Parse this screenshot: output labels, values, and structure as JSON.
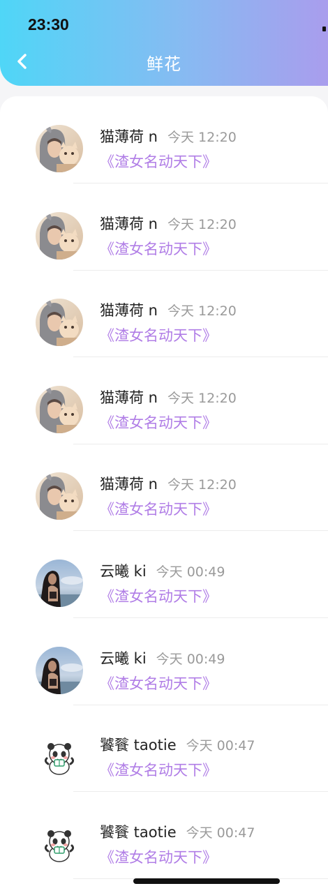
{
  "status_bar": {
    "time": "23:30"
  },
  "header": {
    "title": "鲜花",
    "back_icon": "chevron-left-icon"
  },
  "colors": {
    "header_gradient": [
      "#4fd6f7",
      "#86bbf2",
      "#a99ded"
    ],
    "work_title": "#b07de6",
    "name": "#222222",
    "time": "#9a9a9a"
  },
  "items": [
    {
      "name": "猫薄荷 n",
      "time": "今天 12:20",
      "work": "《渣女名动天下》",
      "avatar": "avatar-cat-girl"
    },
    {
      "name": "猫薄荷 n",
      "time": "今天 12:20",
      "work": "《渣女名动天下》",
      "avatar": "avatar-cat-girl"
    },
    {
      "name": "猫薄荷 n",
      "time": "今天 12:20",
      "work": "《渣女名动天下》",
      "avatar": "avatar-cat-girl"
    },
    {
      "name": "猫薄荷 n",
      "time": "今天 12:20",
      "work": "《渣女名动天下》",
      "avatar": "avatar-cat-girl"
    },
    {
      "name": "猫薄荷 n",
      "time": "今天 12:20",
      "work": "《渣女名动天下》",
      "avatar": "avatar-cat-girl"
    },
    {
      "name": "云曦 ki",
      "time": "今天 00:49",
      "work": "《渣女名动天下》",
      "avatar": "avatar-sky-girl"
    },
    {
      "name": "云曦 ki",
      "time": "今天 00:49",
      "work": "《渣女名动天下》",
      "avatar": "avatar-sky-girl"
    },
    {
      "name": "饕餮 taotie",
      "time": "今天 00:47",
      "work": "《渣女名动天下》",
      "avatar": "avatar-panda"
    },
    {
      "name": "饕餮 taotie",
      "time": "今天 00:47",
      "work": "《渣女名动天下》",
      "avatar": "avatar-panda"
    }
  ]
}
